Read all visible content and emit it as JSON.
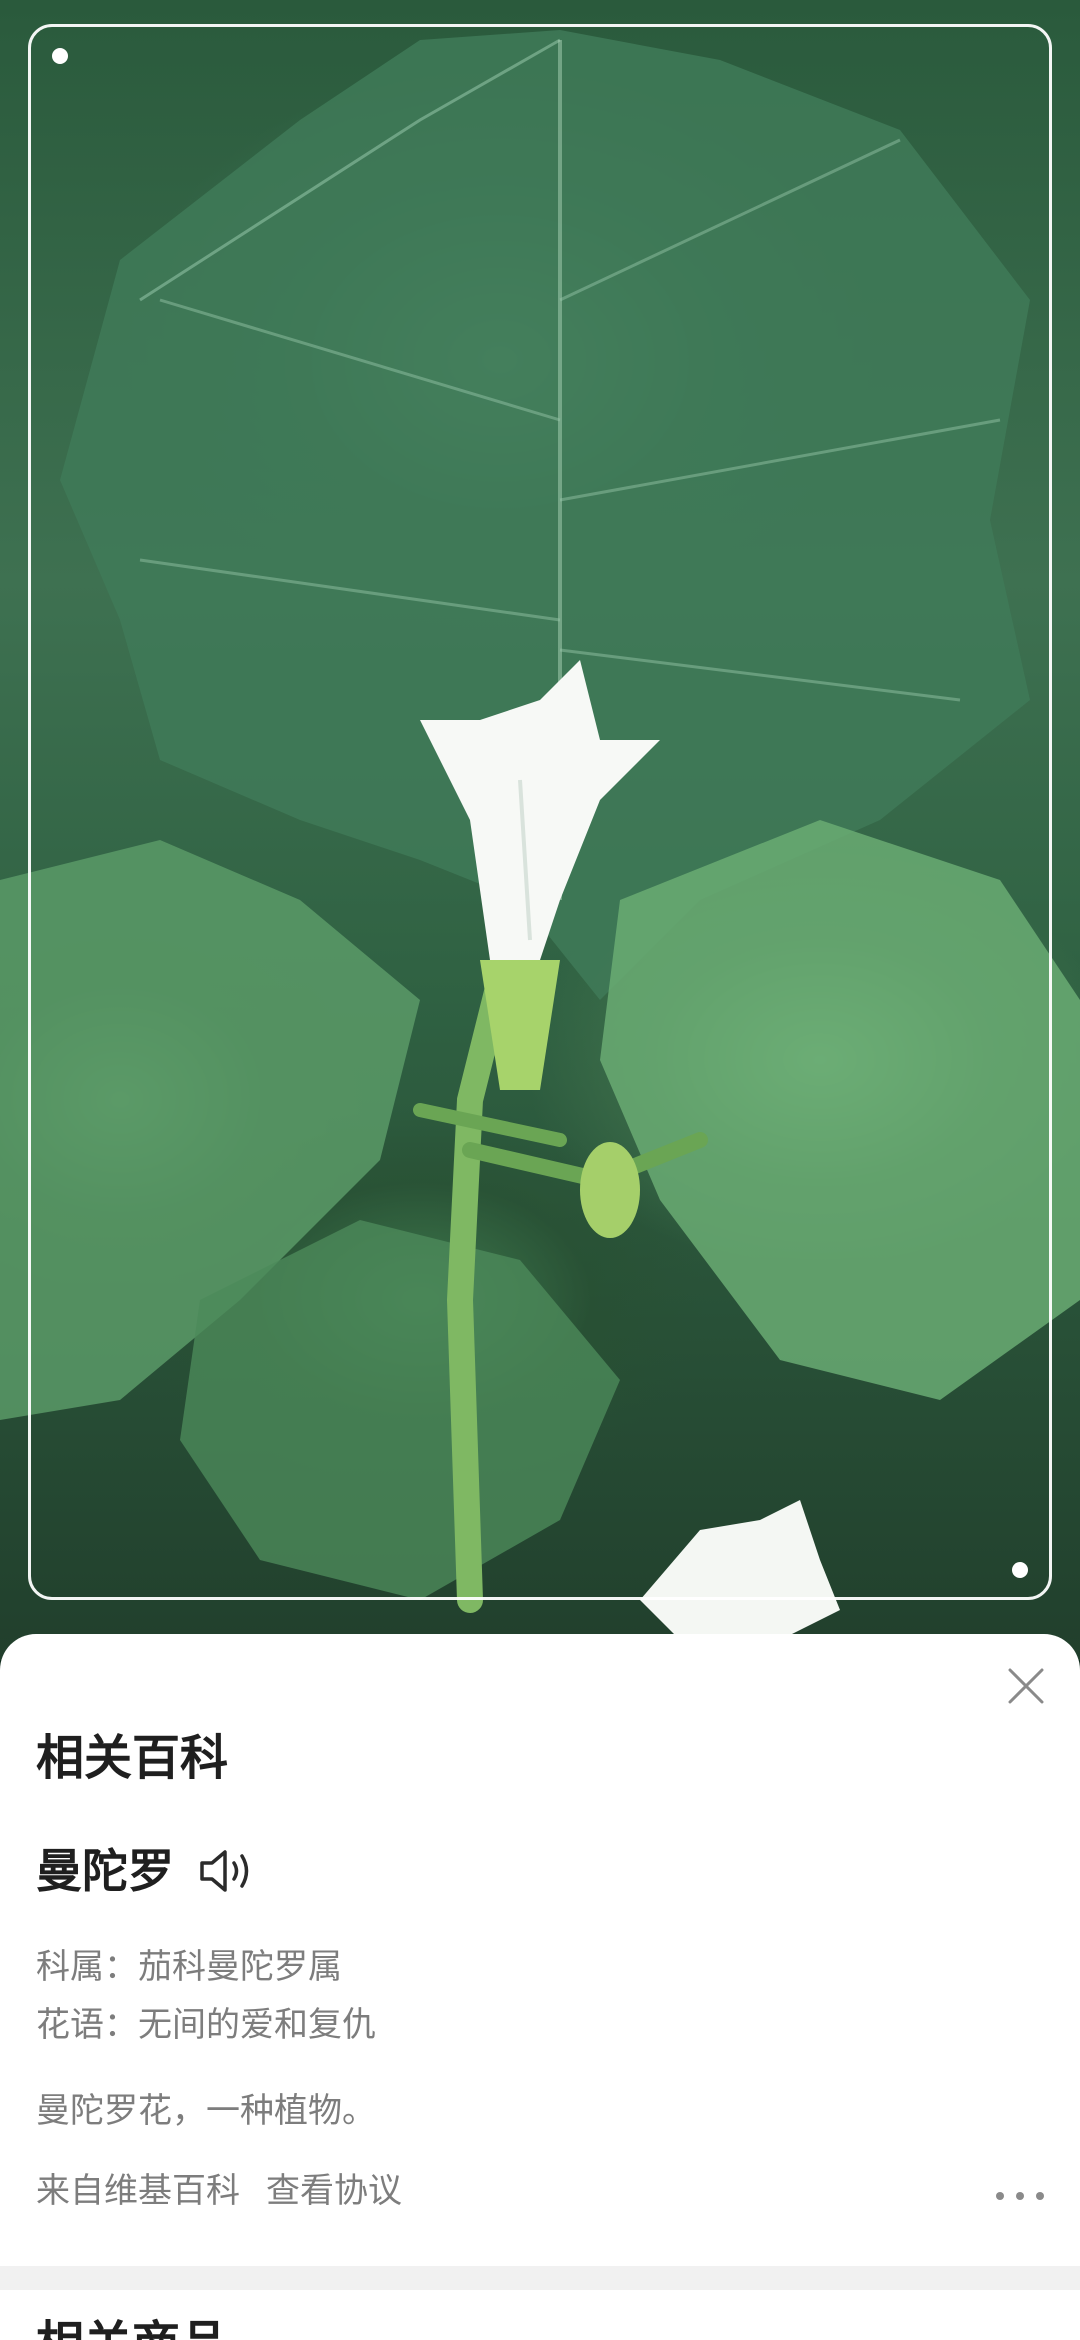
{
  "photo": {
    "subject": "曼陀罗"
  },
  "sheet": {
    "section_title": "相关百科",
    "plant_name": "曼陀罗",
    "family_line": "科属：茄科曼陀罗属",
    "flower_language_line": "花语：无间的爱和复仇",
    "description": "曼陀罗花，一种植物。",
    "source_label": "来自维基百科",
    "agreement_link": "查看协议",
    "next_section_title": "相关商品"
  },
  "icons": {
    "close": "close-icon",
    "speaker": "speaker-icon",
    "more": "more-horizontal-icon"
  },
  "colors": {
    "sheet_bg": "#ffffff",
    "title_text": "#1f1f1f",
    "secondary_text": "#7d7d7d",
    "frame": "#ffffff"
  }
}
